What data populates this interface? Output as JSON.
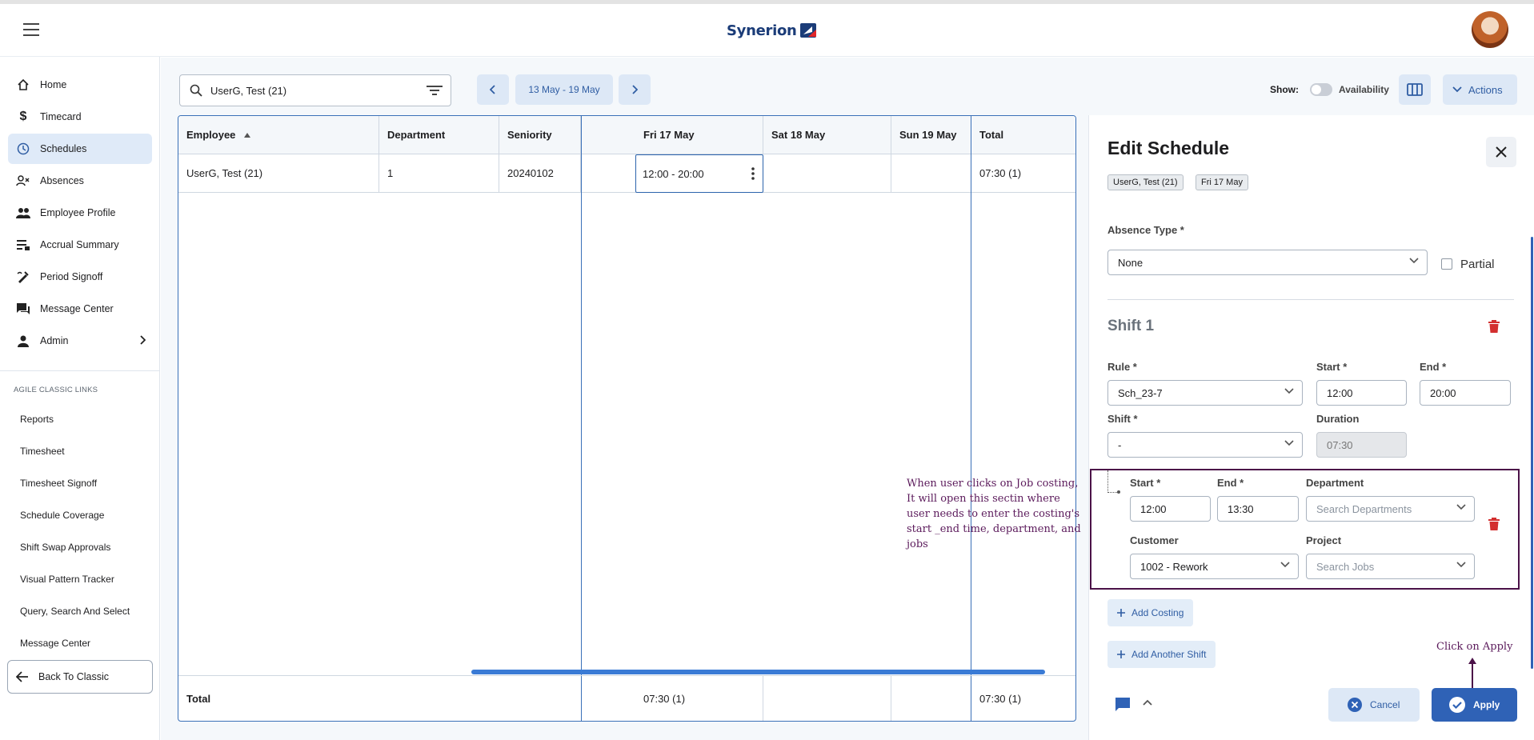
{
  "header": {
    "brand": "Synerion"
  },
  "sidebar": {
    "items": [
      {
        "label": "Home",
        "icon": "home-icon"
      },
      {
        "label": "Timecard",
        "icon": "dollar-icon"
      },
      {
        "label": "Schedules",
        "icon": "clock-icon",
        "active": true
      },
      {
        "label": "Absences",
        "icon": "person-x-icon"
      },
      {
        "label": "Employee Profile",
        "icon": "people-icon"
      },
      {
        "label": "Accrual Summary",
        "icon": "list-icon"
      },
      {
        "label": "Period Signoff",
        "icon": "signoff-icon"
      },
      {
        "label": "Message Center",
        "icon": "chat-icon"
      },
      {
        "label": "Admin",
        "icon": "person-icon"
      }
    ],
    "section_label": "AGILE CLASSIC LINKS",
    "links": [
      "Reports",
      "Timesheet",
      "Timesheet Signoff",
      "Schedule Coverage",
      "Shift Swap Approvals",
      "Visual Pattern Tracker",
      "Query, Search And Select",
      "Message Center"
    ],
    "back_label": "Back To Classic"
  },
  "toolbar": {
    "search_value": "UserG, Test (21)",
    "date_range": "13 May - 19 May",
    "show_label": "Show:",
    "availability_label": "Availability",
    "actions_label": "Actions"
  },
  "grid": {
    "columns": [
      "Employee",
      "Department",
      "Seniority",
      "Fri 17 May",
      "Sat 18 May",
      "Sun 19 May",
      "Total"
    ],
    "row": {
      "employee": "UserG, Test (21)",
      "department": "1",
      "seniority": "20240102",
      "fri": "12:00 - 20:00",
      "total": "07:30 (1)"
    },
    "footer": {
      "label": "Total",
      "fri": "07:30 (1)",
      "total": "07:30 (1)"
    }
  },
  "annotations": {
    "costing_note": "When user clicks on Job costing, It will open this sectin where user needs to enter the costing's start _end time, department, and jobs",
    "apply_note": "Click on Apply"
  },
  "panel": {
    "title": "Edit Schedule",
    "chips": [
      "UserG, Test (21)",
      "Fri 17 May"
    ],
    "absence_type_label": "Absence Type *",
    "absence_type_value": "None",
    "partial_label": "Partial",
    "shift_title": "Shift 1",
    "rule_label": "Rule *",
    "rule_value": "Sch_23-7",
    "start_label": "Start *",
    "start_value": "12:00",
    "end_label": "End *",
    "end_value": "20:00",
    "shift_label": "Shift *",
    "shift_value": "-",
    "duration_label": "Duration",
    "duration_value": "07:30",
    "costing": {
      "start_label": "Start *",
      "start_value": "12:00",
      "end_label": "End *",
      "end_value": "13:30",
      "department_label": "Department",
      "department_placeholder": "Search Departments",
      "customer_label": "Customer",
      "customer_value": "1002 - Rework",
      "project_label": "Project",
      "project_placeholder": "Search Jobs"
    },
    "add_costing_label": "Add Costing",
    "add_shift_label": "Add Another Shift",
    "cancel_label": "Cancel",
    "apply_label": "Apply"
  },
  "colors": {
    "accent": "#2f62b6",
    "annotation": "#5b1a5b",
    "delete": "#d32f2f"
  }
}
